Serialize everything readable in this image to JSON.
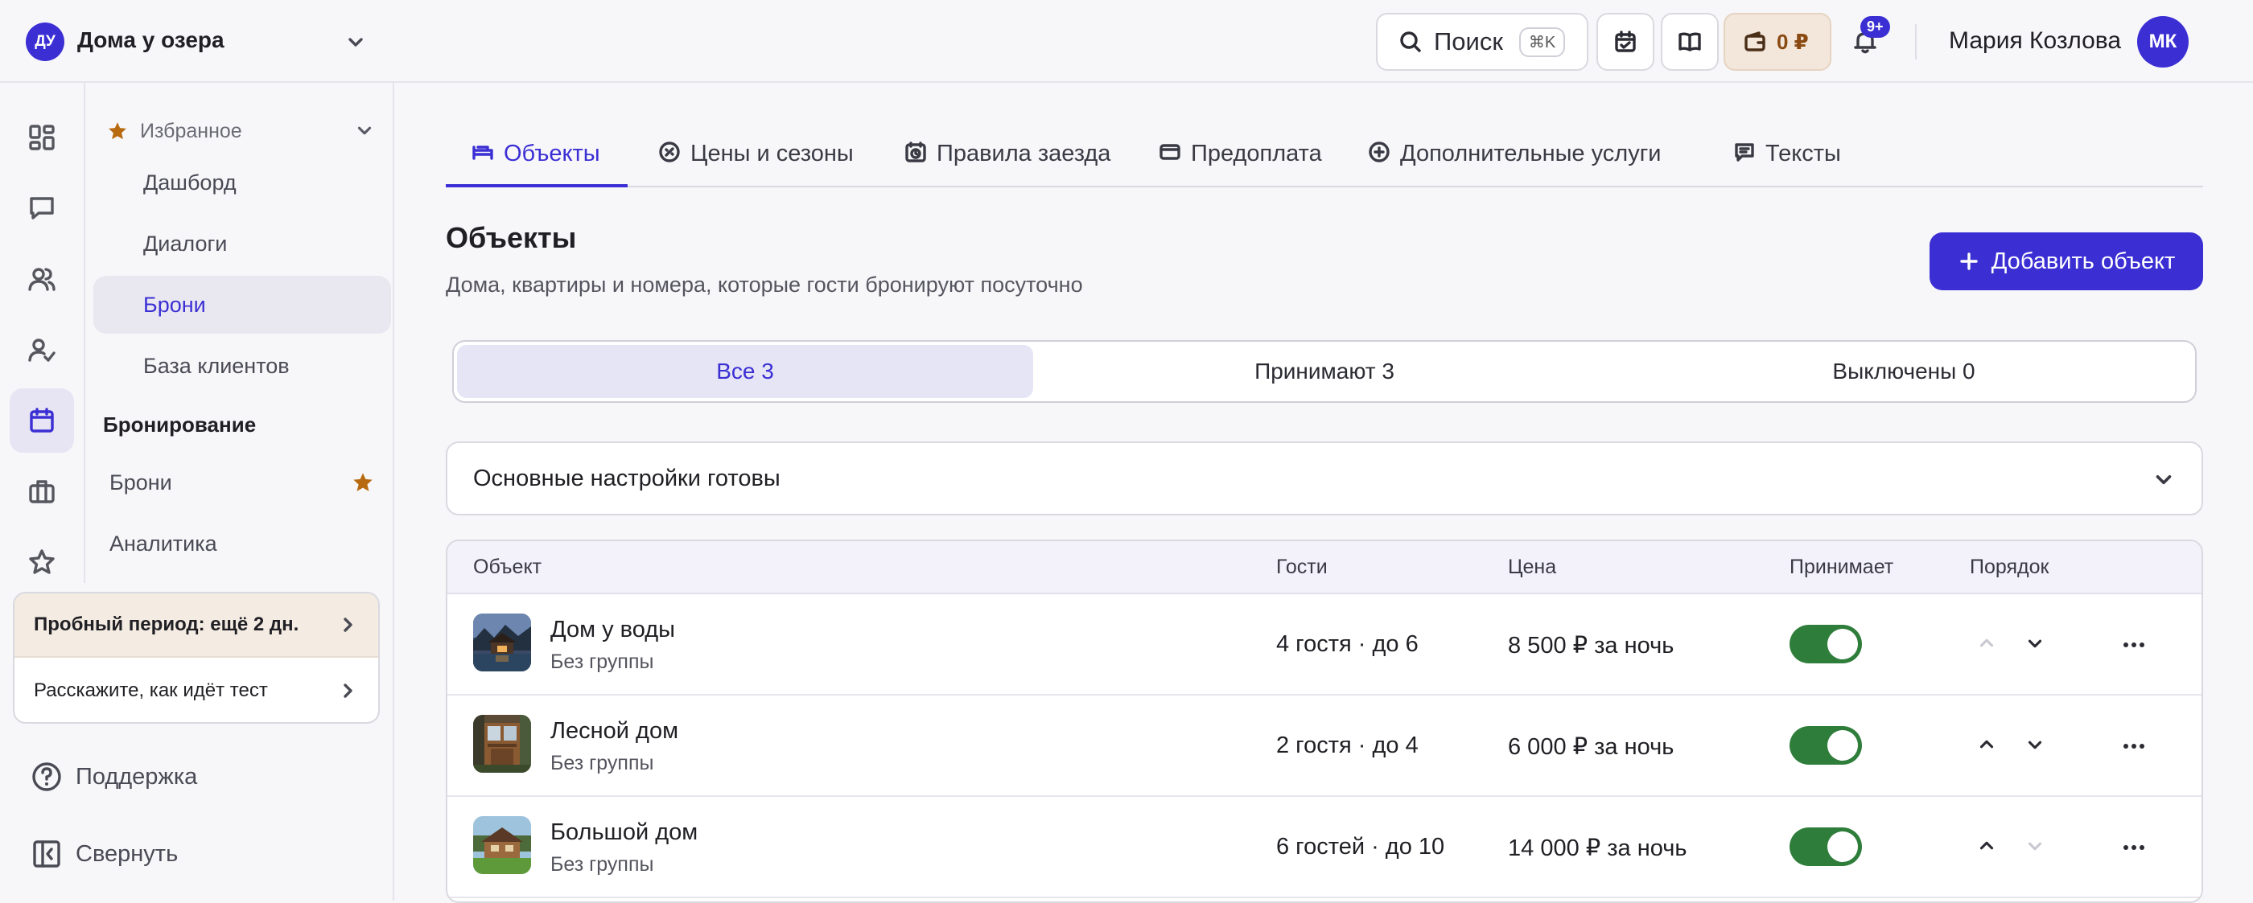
{
  "workspace": {
    "initials": "ДУ",
    "name": "Дома у озера"
  },
  "topbar": {
    "search_label": "Поиск",
    "search_shortcut": "⌘K",
    "wallet_amount": "0 ₽",
    "notifications_badge": "9+",
    "user_name": "Мария Козлова",
    "user_initials": "МК"
  },
  "nav": {
    "favorites_title": "Избранное",
    "favorites": [
      {
        "label": "Дашборд"
      },
      {
        "label": "Диалоги"
      },
      {
        "label": "Брони"
      },
      {
        "label": "База клиентов"
      }
    ],
    "section_title": "Бронирование",
    "section_items": [
      {
        "label": "Брони"
      },
      {
        "label": "Аналитика"
      }
    ],
    "trial": {
      "title": "Пробный период: ещё 2 дн.",
      "feedback": "Расскажите, как идёт тест"
    },
    "support": "Поддержка",
    "collapse": "Свернуть"
  },
  "tabs": [
    {
      "label": "Объекты"
    },
    {
      "label": "Цены и сезоны"
    },
    {
      "label": "Правила заезда"
    },
    {
      "label": "Предоплата"
    },
    {
      "label": "Дополнительные услуги"
    },
    {
      "label": "Тексты"
    }
  ],
  "page": {
    "title": "Объекты",
    "subtitle": "Дома, квартиры и номера, которые гости бронируют посуточно",
    "add_button": "Добавить объект"
  },
  "filters": [
    {
      "label": "Все 3"
    },
    {
      "label": "Принимают 3"
    },
    {
      "label": "Выключены 0"
    }
  ],
  "accordion": {
    "label": "Основные настройки готовы"
  },
  "table": {
    "headers": {
      "object": "Объект",
      "guests": "Гости",
      "price": "Цена",
      "accepts": "Принимает",
      "order": "Порядок"
    },
    "rows": [
      {
        "name": "Дом у воды",
        "group": "Без группы",
        "guests": "4 гостя · до 6",
        "price": "8 500 ₽ за ночь",
        "accepts": true
      },
      {
        "name": "Лесной дом",
        "group": "Без группы",
        "guests": "2 гостя · до 4",
        "price": "6 000 ₽ за ночь",
        "accepts": true
      },
      {
        "name": "Большой дом",
        "group": "Без группы",
        "guests": "6 гостей · до 10",
        "price": "14 000 ₽ за ночь",
        "accepts": true
      }
    ]
  },
  "colors": {
    "accent": "#3b2fd4",
    "toggle_on": "#2f7d3b",
    "favorite_star": "#b86a10",
    "trial_bg": "#f4ebe2"
  }
}
